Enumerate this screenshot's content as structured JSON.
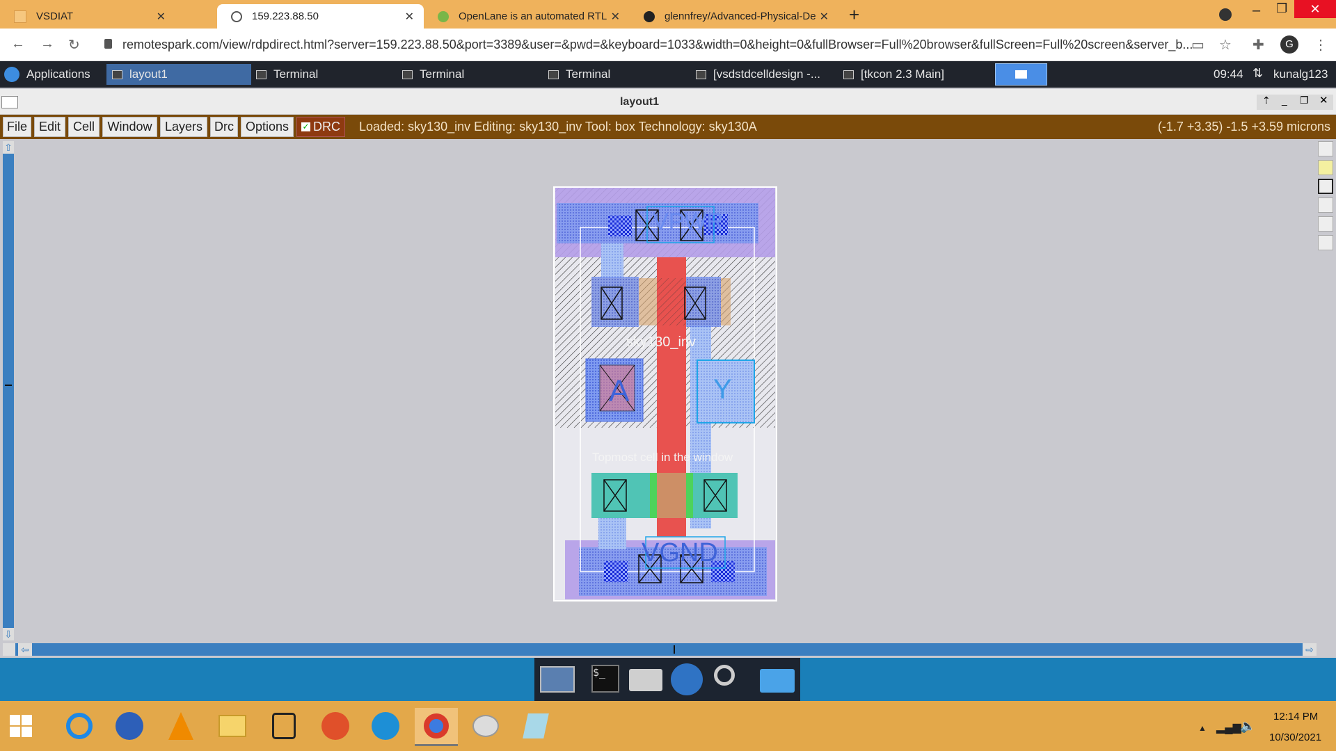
{
  "browser": {
    "tabs": [
      {
        "label": "VSDIAT",
        "active": false
      },
      {
        "label": "159.223.88.50",
        "active": true
      },
      {
        "label": "OpenLane is an automated RTL t",
        "active": false
      },
      {
        "label": "glennfrey/Advanced-Physical-De",
        "active": false
      }
    ],
    "new_tab": "+",
    "url": "remotespark.com/view/rdpdirect.html?server=159.223.88.50&port=3389&user=&pwd=&keyboard=1033&width=0&height=0&fullBrowser=Full%20browser&fullScreen=Full%20screen&server_b...",
    "profile_initial": "G"
  },
  "xfce_panel": {
    "applications": "Applications",
    "tasks": [
      "layout1",
      "Terminal",
      "Terminal",
      "Terminal",
      "[vsdstdcelldesign -...",
      "[tkcon 2.3 Main]"
    ],
    "clock": "09:44",
    "user": "kunalg123"
  },
  "magic": {
    "window_title": "layout1",
    "menus": [
      "File",
      "Edit",
      "Cell",
      "Window",
      "Layers",
      "Drc",
      "Options"
    ],
    "drc_label": "DRC",
    "drc_checked": true,
    "status": "Loaded: sky130_inv Editing: sky130_inv Tool: box  Technology: sky130A",
    "coords": "(-1.7 +3.35) -1.5 +3.59 microns"
  },
  "layout": {
    "labels": {
      "vpwr": "VPWR",
      "cell": "sky130_inv",
      "pin_a": "A",
      "pin_y": "Y",
      "topmost": "Topmost cell in the window",
      "vgnd": "VGND"
    },
    "colors": {
      "poly": "#e8524f",
      "diff": "#4dd35b",
      "metal": "#4a6ce0",
      "nwell": "#9b7bd9",
      "background": "#c9c9cf"
    }
  },
  "windows_taskbar": {
    "time": "12:14 PM",
    "date": "10/30/2021"
  }
}
